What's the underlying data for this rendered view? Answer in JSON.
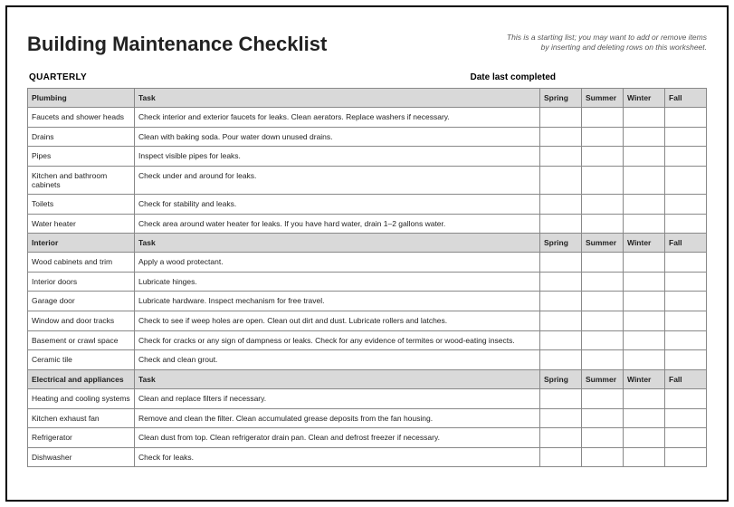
{
  "title": "Building Maintenance Checklist",
  "subtitle_line1": "This is a starting list; you may want to add or remove items",
  "subtitle_line2": "by inserting and deleting rows on this worksheet.",
  "period_label": "QUARTERLY",
  "date_label": "Date last completed",
  "columns": {
    "task": "Task",
    "spring": "Spring",
    "summer": "Summer",
    "winter": "Winter",
    "fall": "Fall"
  },
  "sections": [
    {
      "name": "Plumbing",
      "rows": [
        {
          "item": "Faucets and shower heads",
          "task": "Check interior and exterior faucets for leaks. Clean aerators. Replace washers if necessary."
        },
        {
          "item": "Drains",
          "task": "Clean with baking soda. Pour water down unused drains."
        },
        {
          "item": "Pipes",
          "task": "Inspect visible pipes for leaks."
        },
        {
          "item": "Kitchen and bathroom cabinets",
          "task": "Check under and around for leaks."
        },
        {
          "item": "Toilets",
          "task": "Check for stability and leaks."
        },
        {
          "item": "Water heater",
          "task": "Check area around water heater for leaks. If you have hard water, drain 1–2 gallons water."
        }
      ]
    },
    {
      "name": "Interior",
      "rows": [
        {
          "item": "Wood cabinets and trim",
          "task": "Apply a wood protectant."
        },
        {
          "item": "Interior doors",
          "task": "Lubricate hinges."
        },
        {
          "item": "Garage door",
          "task": "Lubricate hardware. Inspect mechanism for free travel."
        },
        {
          "item": "Window and door tracks",
          "task": "Check to see if weep holes are open. Clean out dirt and dust. Lubricate rollers and latches."
        },
        {
          "item": "Basement or crawl space",
          "task": "Check for cracks or any sign of dampness or leaks. Check for any evidence of termites or wood-eating insects."
        },
        {
          "item": "Ceramic tile",
          "task": "Check and clean grout."
        }
      ]
    },
    {
      "name": "Electrical and appliances",
      "rows": [
        {
          "item": "Heating and cooling systems",
          "task": "Clean and replace filters if necessary."
        },
        {
          "item": "Kitchen exhaust fan",
          "task": "Remove and clean the filter. Clean accumulated grease deposits from the fan housing."
        },
        {
          "item": "Refrigerator",
          "task": "Clean dust from top. Clean refrigerator drain pan. Clean and defrost freezer if necessary."
        },
        {
          "item": "Dishwasher",
          "task": "Check for leaks."
        }
      ]
    }
  ]
}
